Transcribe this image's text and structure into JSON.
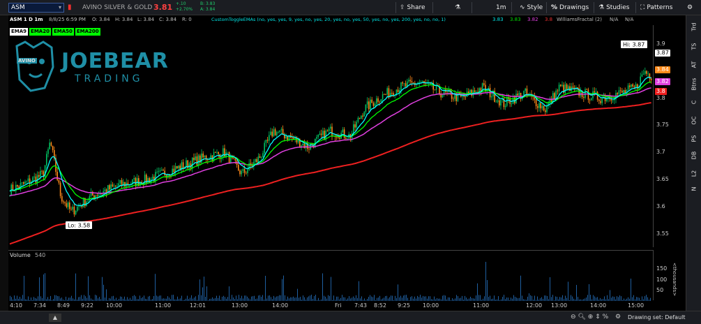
{
  "toolbar": {
    "symbol": "ASM",
    "company": "AVINO SILVER & GOLD",
    "last": "3.81",
    "change_abs": "+.10",
    "change_pct": "+2.70%",
    "bid": "B: 3.83",
    "ask": "A: 3.84",
    "share": "Share",
    "timeframe": "1m",
    "style": "Style",
    "drawings": "Drawings",
    "studies": "Studies",
    "patterns": "Patterns"
  },
  "info": {
    "chart_id": "ASM 1 D 1m",
    "datetime": "8/8/25 6:59 PM",
    "open": "O: 3.84",
    "high": "H: 3.84",
    "low": "L: 3.84",
    "close": "C: 3.84",
    "range": "R: 0",
    "study": "CustomToggleEMAs (no, yes, yes, 9, yes, no, yes, 20, yes, no, yes, 50, yes, no, yes, 200, yes, no, no, 1)",
    "v1": "3.83",
    "v2": "3.83",
    "v3": "3.82",
    "v4": "3.8",
    "fractal": "WilliamsFractal (2)",
    "na1": "N/A",
    "na2": "N/A"
  },
  "ema_tags": [
    "EMA9",
    "EMA20",
    "EMA50",
    "EMA200"
  ],
  "colors": {
    "ema9": "#00ffff",
    "ema20": "#00ff00",
    "ema50": "#e040e0",
    "ema200": "#ee2020",
    "candle_up": "#00c060",
    "candle_down": "#ff8a1a",
    "volume": "#1f5fa0"
  },
  "logo": {
    "name": "JOEBEAR",
    "sub": "TRADING",
    "badge": "AVINO"
  },
  "price_axis": [
    "3.9",
    "3.85",
    "3.8",
    "3.75",
    "3.7",
    "3.65",
    "3.6",
    "3.55"
  ],
  "price_badges": {
    "hi": "3.87",
    "orange": "3.84",
    "magenta": "3.82",
    "red": "3.8"
  },
  "hi_label": "Hi: 3.87",
  "lo_label": "Lo: 3.58",
  "volume": {
    "label": "Volume",
    "value": "540",
    "axis": [
      "150",
      "100",
      "50"
    ],
    "unit": "<thousands>"
  },
  "time_axis": [
    "4:10",
    "7:34",
    "8:49",
    "9:22",
    "10:00",
    "11:00",
    "12:01",
    "13:00",
    "14:00",
    "Fri",
    "7:43",
    "8:52",
    "9:25",
    "10:00",
    "11:00",
    "12:00",
    "13:00",
    "14:00",
    "15:00"
  ],
  "right_tabs": [
    "Trd",
    "TS",
    "AT",
    "Btns",
    "C",
    "OC",
    "PS",
    "DB",
    "L2",
    "N"
  ],
  "drawing_set": "Drawing set: Default"
}
